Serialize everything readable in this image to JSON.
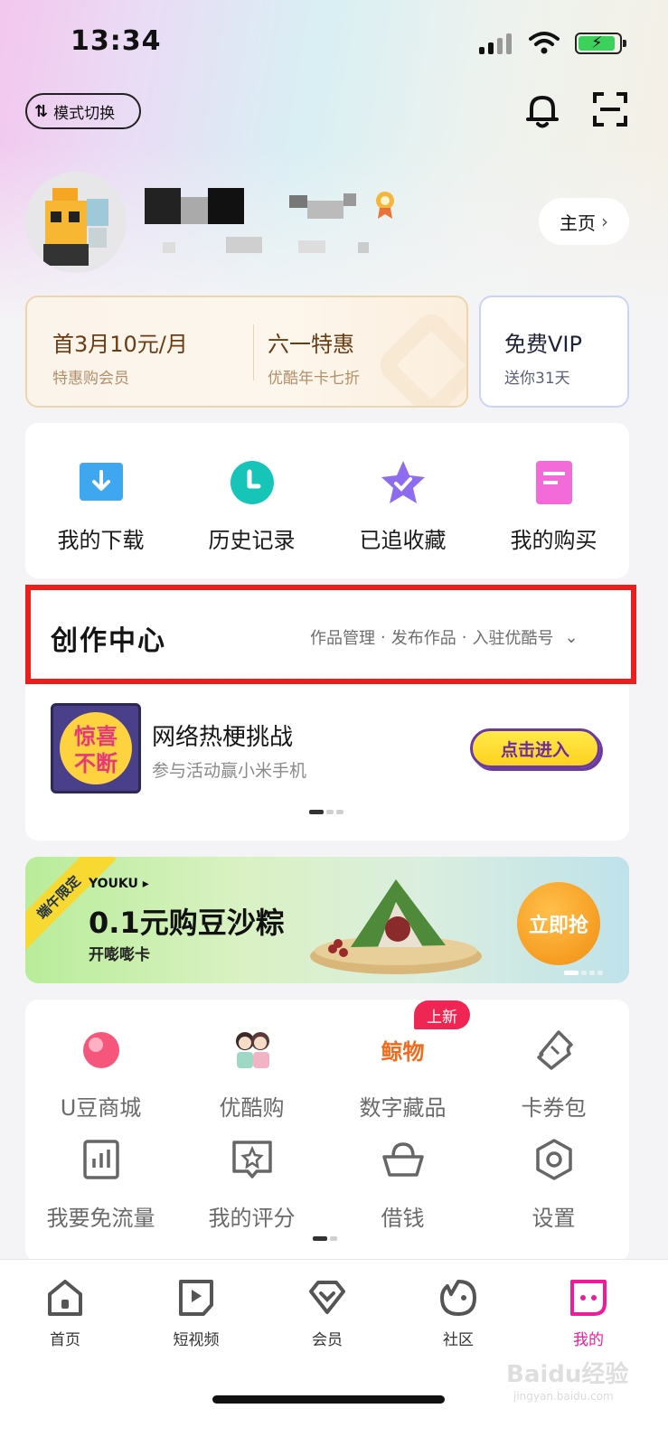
{
  "status_bar": {
    "time": "13:34"
  },
  "header": {
    "mode_switch_label": "模式切换"
  },
  "profile": {
    "home_label": "主页"
  },
  "vip": {
    "offer1_title": "首3月10元/月",
    "offer1_sub": "特惠购会员",
    "offer2_title": "六一特惠",
    "offer2_sub": "优酷年卡七折",
    "free_title": "免费VIP",
    "free_sub": "送你31天"
  },
  "quick_actions": [
    {
      "label": "我的下载",
      "icon": "download-icon",
      "color": "#3fa7f0"
    },
    {
      "label": "历史记录",
      "icon": "clock-icon",
      "color": "#16c4b8"
    },
    {
      "label": "已追收藏",
      "icon": "star-icon",
      "color": "#8d6cf0"
    },
    {
      "label": "我的购买",
      "icon": "receipt-icon",
      "color": "#f36ad9"
    }
  ],
  "creation_center": {
    "title": "创作中心",
    "links": [
      "作品管理",
      "发布作品",
      "入驻优酷号"
    ],
    "challenge_title": "网络热梗挑战",
    "challenge_sub": "参与活动赢小米手机",
    "enter_label": "点击进入",
    "thumb_text1": "惊喜",
    "thumb_text2": "不断"
  },
  "banner": {
    "ribbon": "端午限定",
    "brand": "YOUKU",
    "main": "0.1元购豆沙粽",
    "sub": "开嘭嘭卡",
    "cta": "立即抢"
  },
  "services": {
    "badge": "上新",
    "items": [
      {
        "label": "U豆商城",
        "icon": "u-bean-icon"
      },
      {
        "label": "优酷购",
        "icon": "youku-shop-icon"
      },
      {
        "label": "数字藏品",
        "icon": "digital-collectible-icon",
        "icon_text": "鲸物"
      },
      {
        "label": "卡券包",
        "icon": "ticket-icon"
      },
      {
        "label": "我要免流量",
        "icon": "data-plan-icon"
      },
      {
        "label": "我的评分",
        "icon": "rating-icon"
      },
      {
        "label": "借钱",
        "icon": "ingot-icon"
      },
      {
        "label": "设置",
        "icon": "settings-icon"
      }
    ]
  },
  "tabbar": [
    {
      "label": "首页",
      "icon": "home-icon",
      "active": false
    },
    {
      "label": "短视频",
      "icon": "play-icon",
      "active": false
    },
    {
      "label": "会员",
      "icon": "diamond-icon",
      "active": false
    },
    {
      "label": "社区",
      "icon": "community-icon",
      "active": false
    },
    {
      "label": "我的",
      "icon": "profile-icon",
      "active": true
    }
  ],
  "watermark": {
    "text": "Baidu经验",
    "sub": "jingyan.baidu.com"
  },
  "colors": {
    "accent": "#ee1c7a",
    "highlight_box": "#ee1c1c",
    "tab_active": "#ee1c9a"
  }
}
